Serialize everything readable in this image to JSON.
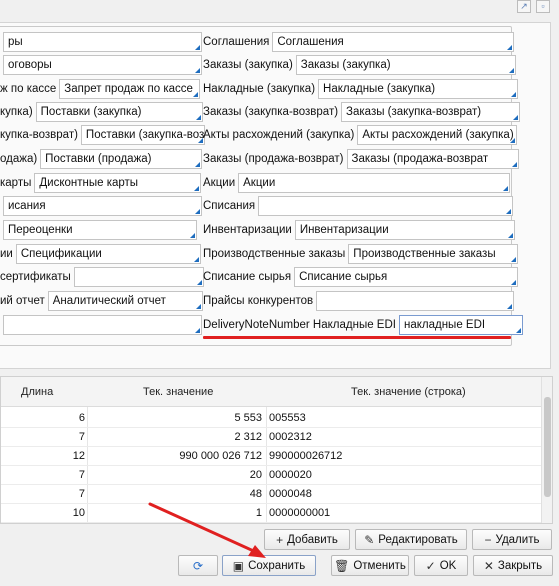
{
  "form": {
    "left_rows": [
      {
        "label": "",
        "value": "ры"
      },
      {
        "label": "",
        "value": "оговоры"
      },
      {
        "label": "ж по кассе",
        "value": "Запрет продаж по кассе"
      },
      {
        "label": "купка)",
        "value": "Поставки (закупка)"
      },
      {
        "label": "купка-возврат)",
        "value": "Поставки (закупка-возв"
      },
      {
        "label": "одажа)",
        "value": "Поставки (продажа)"
      },
      {
        "label": "карты",
        "value": "Дисконтные карты"
      },
      {
        "label": "",
        "value": "исания"
      },
      {
        "label": "",
        "value": "Переоценки"
      },
      {
        "label": "ии",
        "value": "Спецификации"
      },
      {
        "label": "сертификаты",
        "value": ""
      },
      {
        "label": "ий отчет",
        "value": "Аналитический отчет"
      },
      {
        "label": "",
        "value": ""
      }
    ],
    "right_rows": [
      {
        "label": "Соглашения",
        "value": "Соглашения"
      },
      {
        "label": "Заказы (закупка)",
        "value": "Заказы (закупка)"
      },
      {
        "label": "Накладные (закупка)",
        "value": "Накладные (закупка)"
      },
      {
        "label": "Заказы (закупка-возврат)",
        "value": "Заказы (закупка-возврат)"
      },
      {
        "label": "Акты расхождений (закупка)",
        "value": "Акты расхождений (закупка)"
      },
      {
        "label": "Заказы (продажа-возврат)",
        "value": "Заказы (продажа-возврат"
      },
      {
        "label": "Акции",
        "value": "Акции"
      },
      {
        "label": "Списания",
        "value": ""
      },
      {
        "label": "Инвентаризации",
        "value": "Инвентаризации"
      },
      {
        "label": "Производственные заказы",
        "value": "Производственные заказы"
      },
      {
        "label": "Списание сырья",
        "value": "Списание сырья"
      },
      {
        "label": "Прайсы конкурентов",
        "value": ""
      },
      {
        "label": "DeliveryNoteNumber Накладные EDI",
        "value": "накладные EDI"
      }
    ]
  },
  "table": {
    "headers": {
      "length": "Длина",
      "value": "Тек. значение",
      "value_str": "Тек. значение (строка)"
    },
    "rows": [
      {
        "length": "6",
        "value": "5 553",
        "value_str": "005553"
      },
      {
        "length": "7",
        "value": "2 312",
        "value_str": "0002312"
      },
      {
        "length": "12",
        "value": "990 000 026 712",
        "value_str": "990000026712"
      },
      {
        "length": "7",
        "value": "20",
        "value_str": "0000020"
      },
      {
        "length": "7",
        "value": "48",
        "value_str": "0000048"
      },
      {
        "length": "10",
        "value": "1",
        "value_str": "0000000001"
      }
    ]
  },
  "table_toolbar": {
    "add_label": "Добавить",
    "edit_label": "Редактировать",
    "delete_label": "Удалить"
  },
  "footer": {
    "save_label": "Сохранить",
    "cancel_label": "Отменить",
    "ok_label": "OK",
    "close_label": "Закрыть"
  },
  "colors": {
    "accent_blue": "#1e6dbf",
    "annotation_red": "#e02020"
  },
  "icons": {
    "refresh": "refresh-icon",
    "save": "floppy-disk-icon",
    "cancel": "trash-icon",
    "ok": "checkmark-icon",
    "close": "x-icon",
    "add": "plus-icon",
    "edit": "pencil-icon",
    "delete": "minus-icon"
  }
}
